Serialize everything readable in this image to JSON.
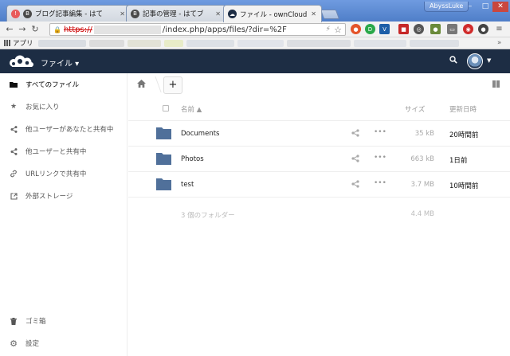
{
  "browser": {
    "tabs": [
      {
        "title": "ブログ記事編集 - はて",
        "favicon_color": "#4a4a4a"
      },
      {
        "title": "記事の管理 - はてブ",
        "favicon_color": "#4a4a4a"
      },
      {
        "title": "ファイル - ownCloud",
        "favicon_color": "#1d2d44"
      }
    ],
    "profile_name": "AbyssLuke",
    "window_controls": [
      "–",
      "□",
      "✕"
    ],
    "address": {
      "scheme": "https://",
      "path": "/index.php/apps/files/?dir=%2F"
    },
    "bookmarks_apps_label": "アプリ",
    "bookmarks_more": "»"
  },
  "header": {
    "app_name": "ファイル ▾"
  },
  "sidebar": {
    "items": [
      {
        "label": "すべてのファイル",
        "icon": "folder-icon"
      },
      {
        "label": "お気に入り",
        "icon": "star-icon"
      },
      {
        "label": "他ユーザーがあなたと共有中",
        "icon": "share-icon"
      },
      {
        "label": "他ユーザーと共有中",
        "icon": "share-icon"
      },
      {
        "label": "URLリンクで共有中",
        "icon": "link-icon"
      },
      {
        "label": "外部ストレージ",
        "icon": "external-icon"
      }
    ],
    "bottom": [
      {
        "label": "ゴミ箱",
        "icon": "trash-icon"
      },
      {
        "label": "設定",
        "icon": "gear-icon"
      }
    ]
  },
  "toolbar": {
    "add_label": "+"
  },
  "table": {
    "col_name": "名前 ▲",
    "col_size": "サイズ",
    "col_modified": "更新日時",
    "rows": [
      {
        "name": "Documents",
        "size": "35 kB",
        "modified": "20時間前"
      },
      {
        "name": "Photos",
        "size": "663 kB",
        "modified": "1日前"
      },
      {
        "name": "test",
        "size": "3.7 MB",
        "modified": "10時間前"
      }
    ],
    "more_label": "•••",
    "summary_count": "3 個のフォルダー",
    "summary_total": "4.4 MB"
  },
  "colors": {
    "header_bg": "#1d2d44",
    "folder": "#50709a"
  }
}
